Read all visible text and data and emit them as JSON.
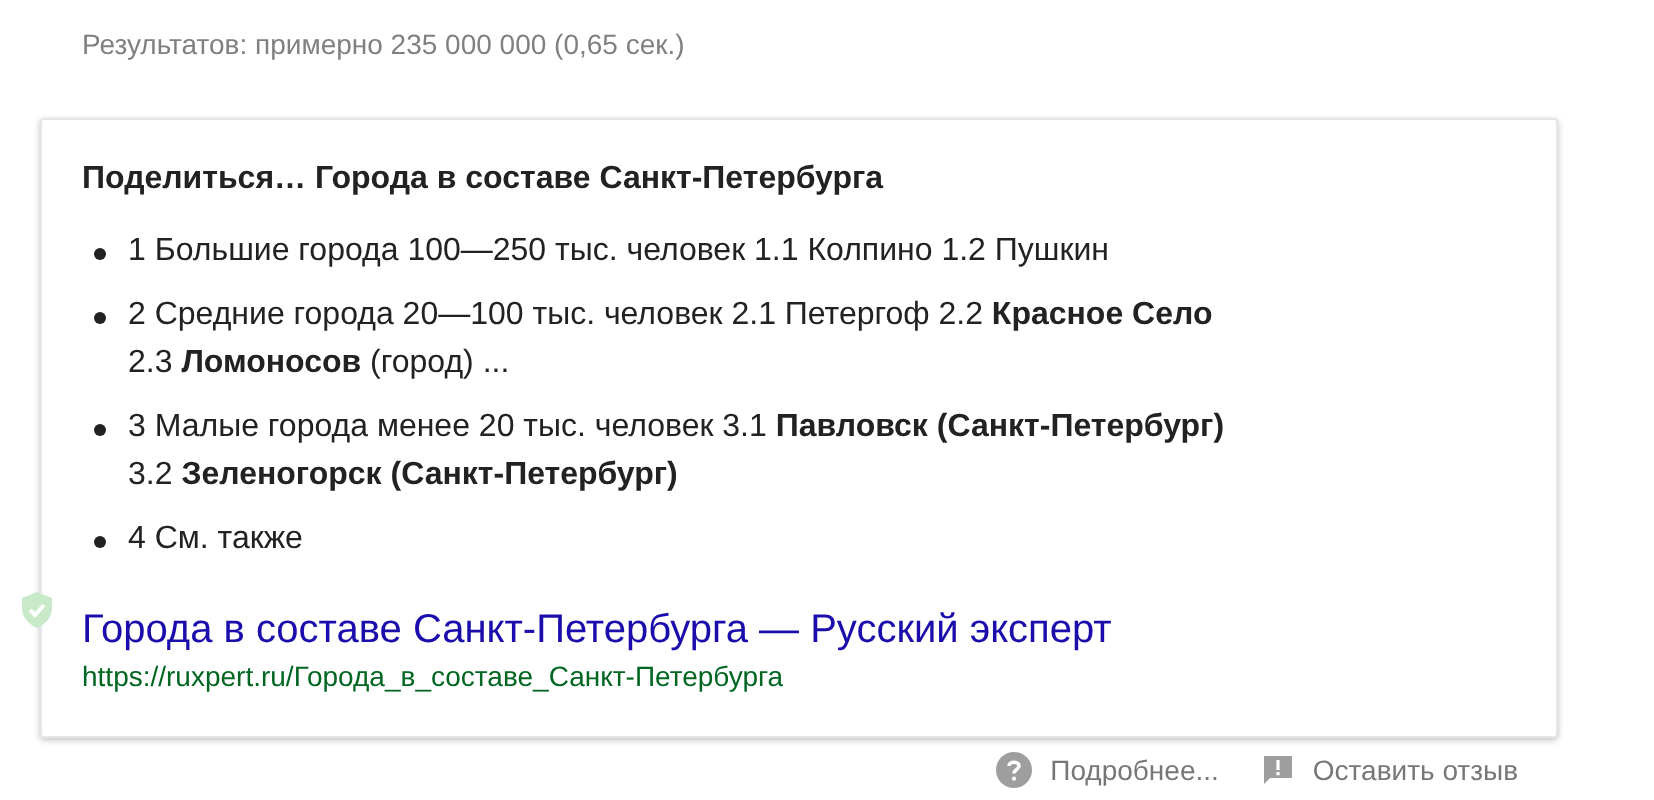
{
  "result_stats": "Результатов: примерно 235 000 000 (0,65 сек.)",
  "snippet": {
    "title": "Поделиться… Города в составе Санкт-Петербурга",
    "items": [
      {
        "lines": [
          "1 Большие города 100—250 тыс. человек 1.1 Колпино 1.2 Пушкин"
        ]
      },
      {
        "lines": [
          "2 Средние города 20—100 тыс. человек 2.1 Петергоф 2.2 **Красное Село**",
          "2.3 **Ломоносов** (город) ..."
        ]
      },
      {
        "lines": [
          "3 Малые города менее 20 тыс. человек 3.1 **Павловск (Санкт-Петербург)**",
          "3.2 **Зеленогорск (Санкт-Петербург)**"
        ]
      },
      {
        "lines": [
          "4 См. также"
        ]
      }
    ],
    "link": {
      "title": "Города в составе Санкт-Петербурга — Русский эксперт",
      "url": "https://ruxpert.ru/Города_в_составе_Санкт-Петербурга"
    }
  },
  "footer": [
    {
      "kind": "help",
      "label": "Подробнее..."
    },
    {
      "kind": "feedback",
      "label": "Оставить отзыв"
    }
  ]
}
